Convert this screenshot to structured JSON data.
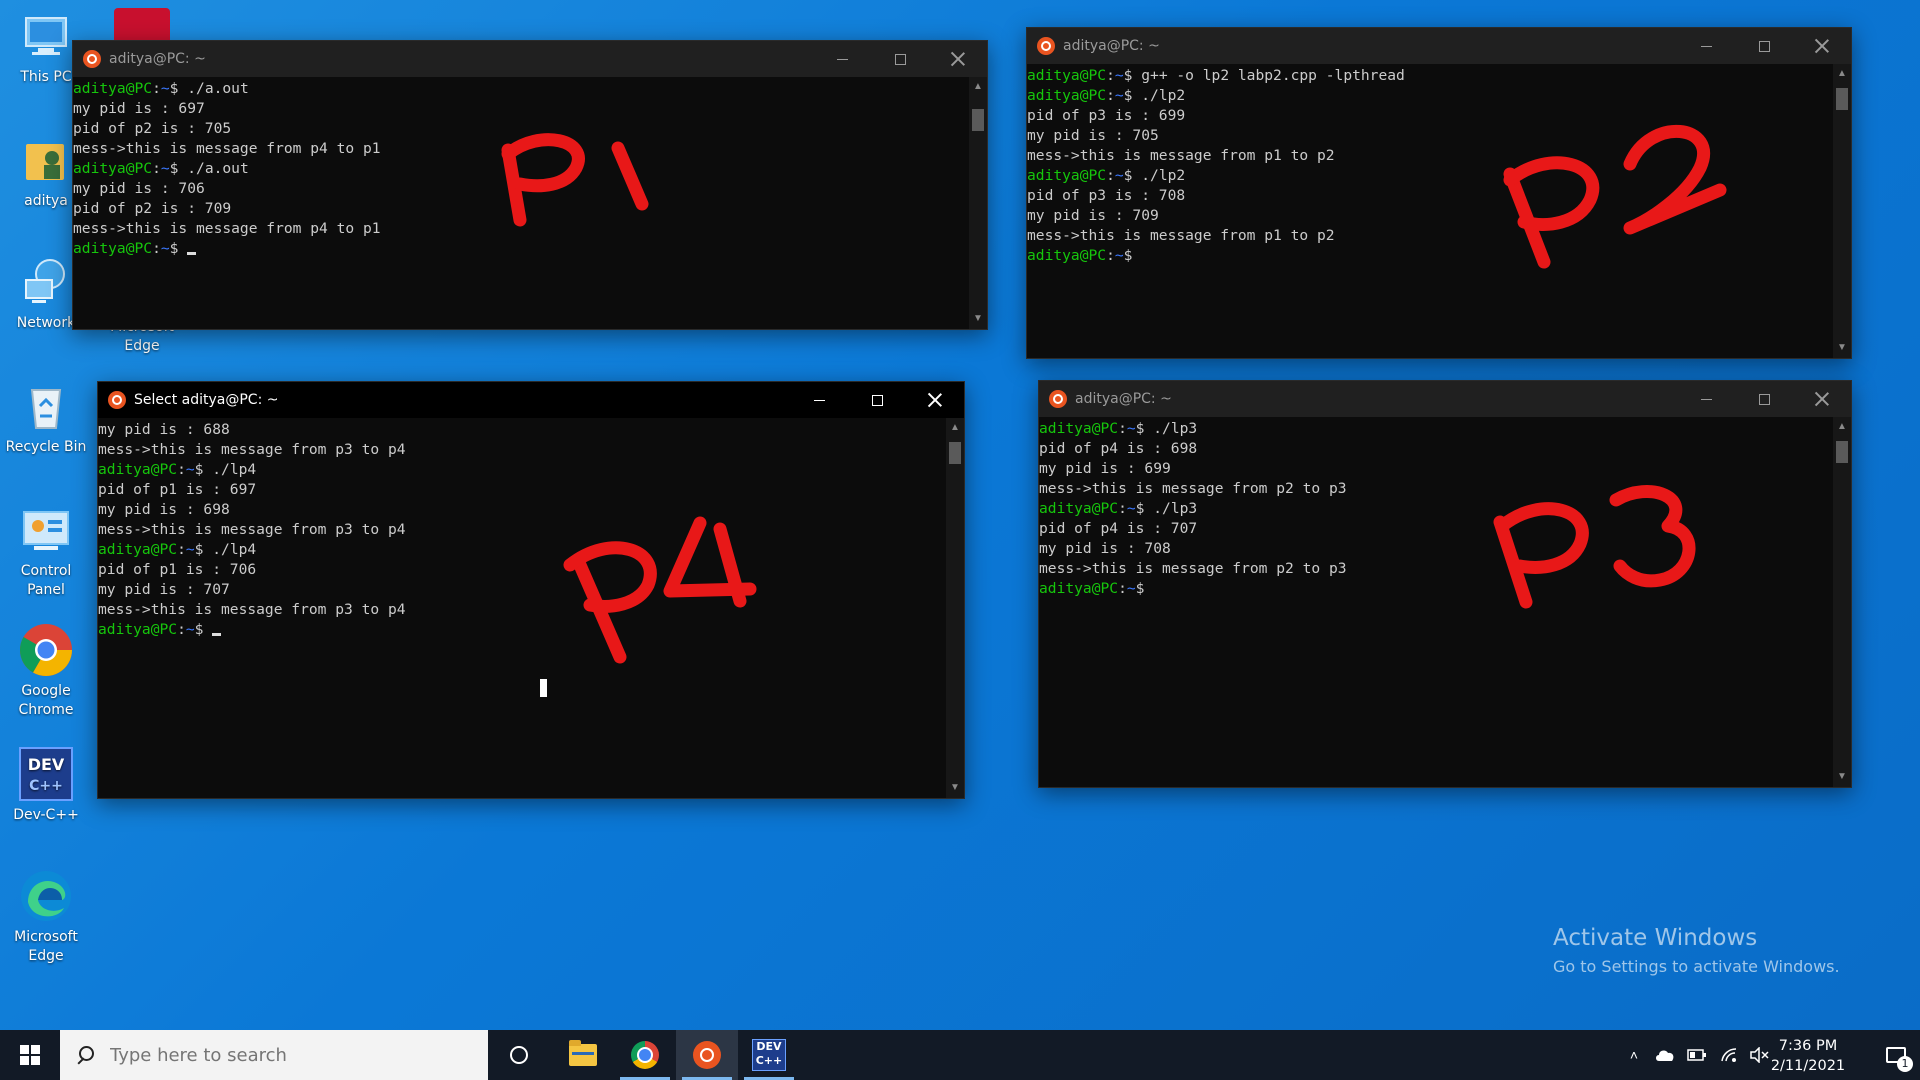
{
  "desktop": {
    "icons": [
      {
        "label": "This PC"
      },
      {
        "label": "aditya"
      },
      {
        "label": "Network"
      },
      {
        "label": "Recycle Bin"
      },
      {
        "label": "Control Panel"
      },
      {
        "label": "Google Chrome"
      },
      {
        "label": "Dev-C++"
      },
      {
        "label": "Microsoft Edge"
      },
      {
        "label": "Microsoft Edge"
      }
    ],
    "activate_title": "Activate Windows",
    "activate_sub": "Go to Settings to activate Windows."
  },
  "windows": {
    "p1": {
      "title": "aditya@PC: ~",
      "lines": [
        {
          "prompt": "aditya@PC",
          "path": "~",
          "cmd": "$ ./a.out"
        },
        {
          "text": "my pid is : 697"
        },
        {
          "text": "pid of p2 is : 705"
        },
        {
          "text": "mess->this is message from p4 to p1"
        },
        {
          "prompt": "aditya@PC",
          "path": "~",
          "cmd": "$ ./a.out"
        },
        {
          "text": "my pid is : 706"
        },
        {
          "text": "pid of p2 is : 709"
        },
        {
          "text": "mess->this is message from p4 to p1"
        },
        {
          "prompt": "aditya@PC",
          "path": "~",
          "cmd": "$ "
        }
      ],
      "annotation": "P1"
    },
    "p2": {
      "title": "aditya@PC: ~",
      "lines": [
        {
          "prompt": "aditya@PC",
          "path": "~",
          "cmd": "$ g++ -o lp2 labp2.cpp -lpthread"
        },
        {
          "prompt": "aditya@PC",
          "path": "~",
          "cmd": "$ ./lp2"
        },
        {
          "text": "pid of p3 is : 699"
        },
        {
          "text": "my pid is : 705"
        },
        {
          "text": "mess->this is message from p1 to p2"
        },
        {
          "prompt": "aditya@PC",
          "path": "~",
          "cmd": "$ ./lp2"
        },
        {
          "text": "pid of p3 is : 708"
        },
        {
          "text": "my pid is : 709"
        },
        {
          "text": "mess->this is message from p1 to p2"
        },
        {
          "prompt": "aditya@PC",
          "path": "~",
          "cmd": "$"
        }
      ],
      "annotation": "P2"
    },
    "p3": {
      "title": "aditya@PC: ~",
      "lines": [
        {
          "prompt": "aditya@PC",
          "path": "~",
          "cmd": "$ ./lp3"
        },
        {
          "text": "pid of p4 is : 698"
        },
        {
          "text": "my pid is : 699"
        },
        {
          "text": "mess->this is message from p2 to p3"
        },
        {
          "prompt": "aditya@PC",
          "path": "~",
          "cmd": "$ ./lp3"
        },
        {
          "text": "pid of p4 is : 707"
        },
        {
          "text": "my pid is : 708"
        },
        {
          "text": "mess->this is message from p2 to p3"
        },
        {
          "prompt": "aditya@PC",
          "path": "~",
          "cmd": "$"
        }
      ],
      "annotation": "P3"
    },
    "p4": {
      "title": "Select aditya@PC: ~",
      "lines": [
        {
          "text": "my pid is : 688"
        },
        {
          "text": "mess->this is message from p3 to p4"
        },
        {
          "prompt": "aditya@PC",
          "path": "~",
          "cmd": "$ ./lp4"
        },
        {
          "text": "pid of p1 is : 697"
        },
        {
          "text": "my pid is : 698"
        },
        {
          "text": "mess->this is message from p3 to p4"
        },
        {
          "prompt": "aditya@PC",
          "path": "~",
          "cmd": "$ ./lp4"
        },
        {
          "text": "pid of p1 is : 706"
        },
        {
          "text": "my pid is : 707"
        },
        {
          "text": "mess->this is message from p3 to p4"
        },
        {
          "prompt": "aditya@PC",
          "path": "~",
          "cmd": "$ "
        }
      ],
      "annotation": "P4"
    }
  },
  "taskbar": {
    "search_placeholder": "Type here to search",
    "time": "7:36 PM",
    "date": "2/11/2021",
    "notification_count": "1",
    "colors": {
      "background": "#121a26",
      "search": "#f3f3f3",
      "active_indicator": "#7cb8ef"
    }
  },
  "colors": {
    "prompt": "#16c60c",
    "path": "#3b78ff",
    "terminal_bg": "#0c0c0c",
    "annotation": "#e81818",
    "ubuntu": "#e95420"
  }
}
